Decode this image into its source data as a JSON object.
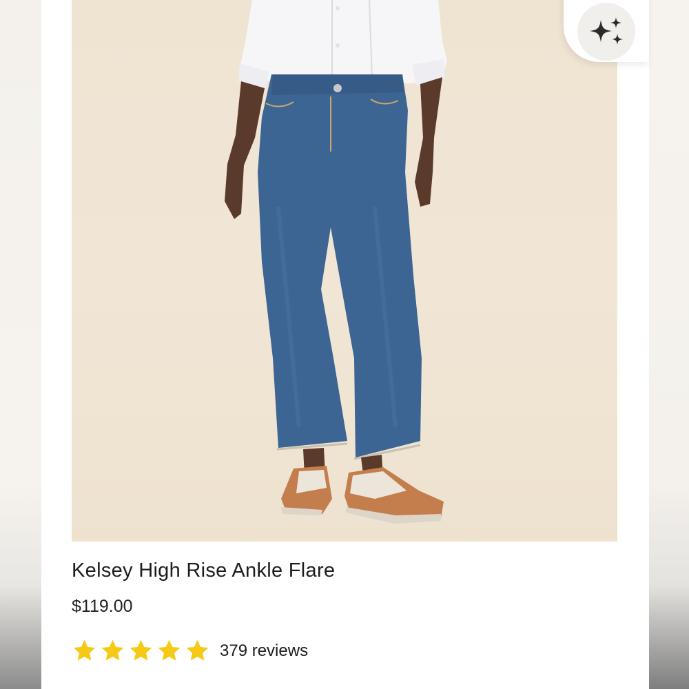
{
  "product": {
    "title": "Kelsey High Rise Ankle Flare",
    "price": "$119.00",
    "rating": 5,
    "rating_max": 5,
    "reviews_label": "379 reviews",
    "image_icon": "product-photo"
  },
  "ai_button": {
    "icon": "sparkles-icon"
  },
  "colors": {
    "star": "#f6c915",
    "image_background": "#f0e4d3",
    "denim": "#3c6594",
    "text": "#1c1c1c"
  }
}
